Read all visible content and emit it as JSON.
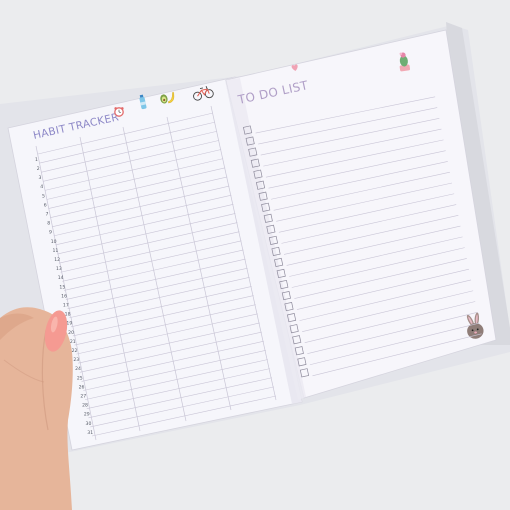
{
  "left_page": {
    "title": "HABIT TRACKER",
    "icons": [
      "alarm-clock-icon",
      "water-bottle-icon",
      "avocado-banana-icon",
      "bicycle-icon"
    ],
    "day_count": 31
  },
  "right_page": {
    "title": "TO DO LIST",
    "icons": [
      "heart-icon",
      "cactus-icon",
      "bunny-icon"
    ],
    "checkbox_count": 23
  },
  "colors": {
    "background": "#e9eaec",
    "page": "#f6f5fb",
    "title": "#8c87c7",
    "todo_title": "#b09fc7",
    "lines": "#c9c5d6",
    "nail": "#f59a92",
    "skin": "#e8b9a0"
  }
}
